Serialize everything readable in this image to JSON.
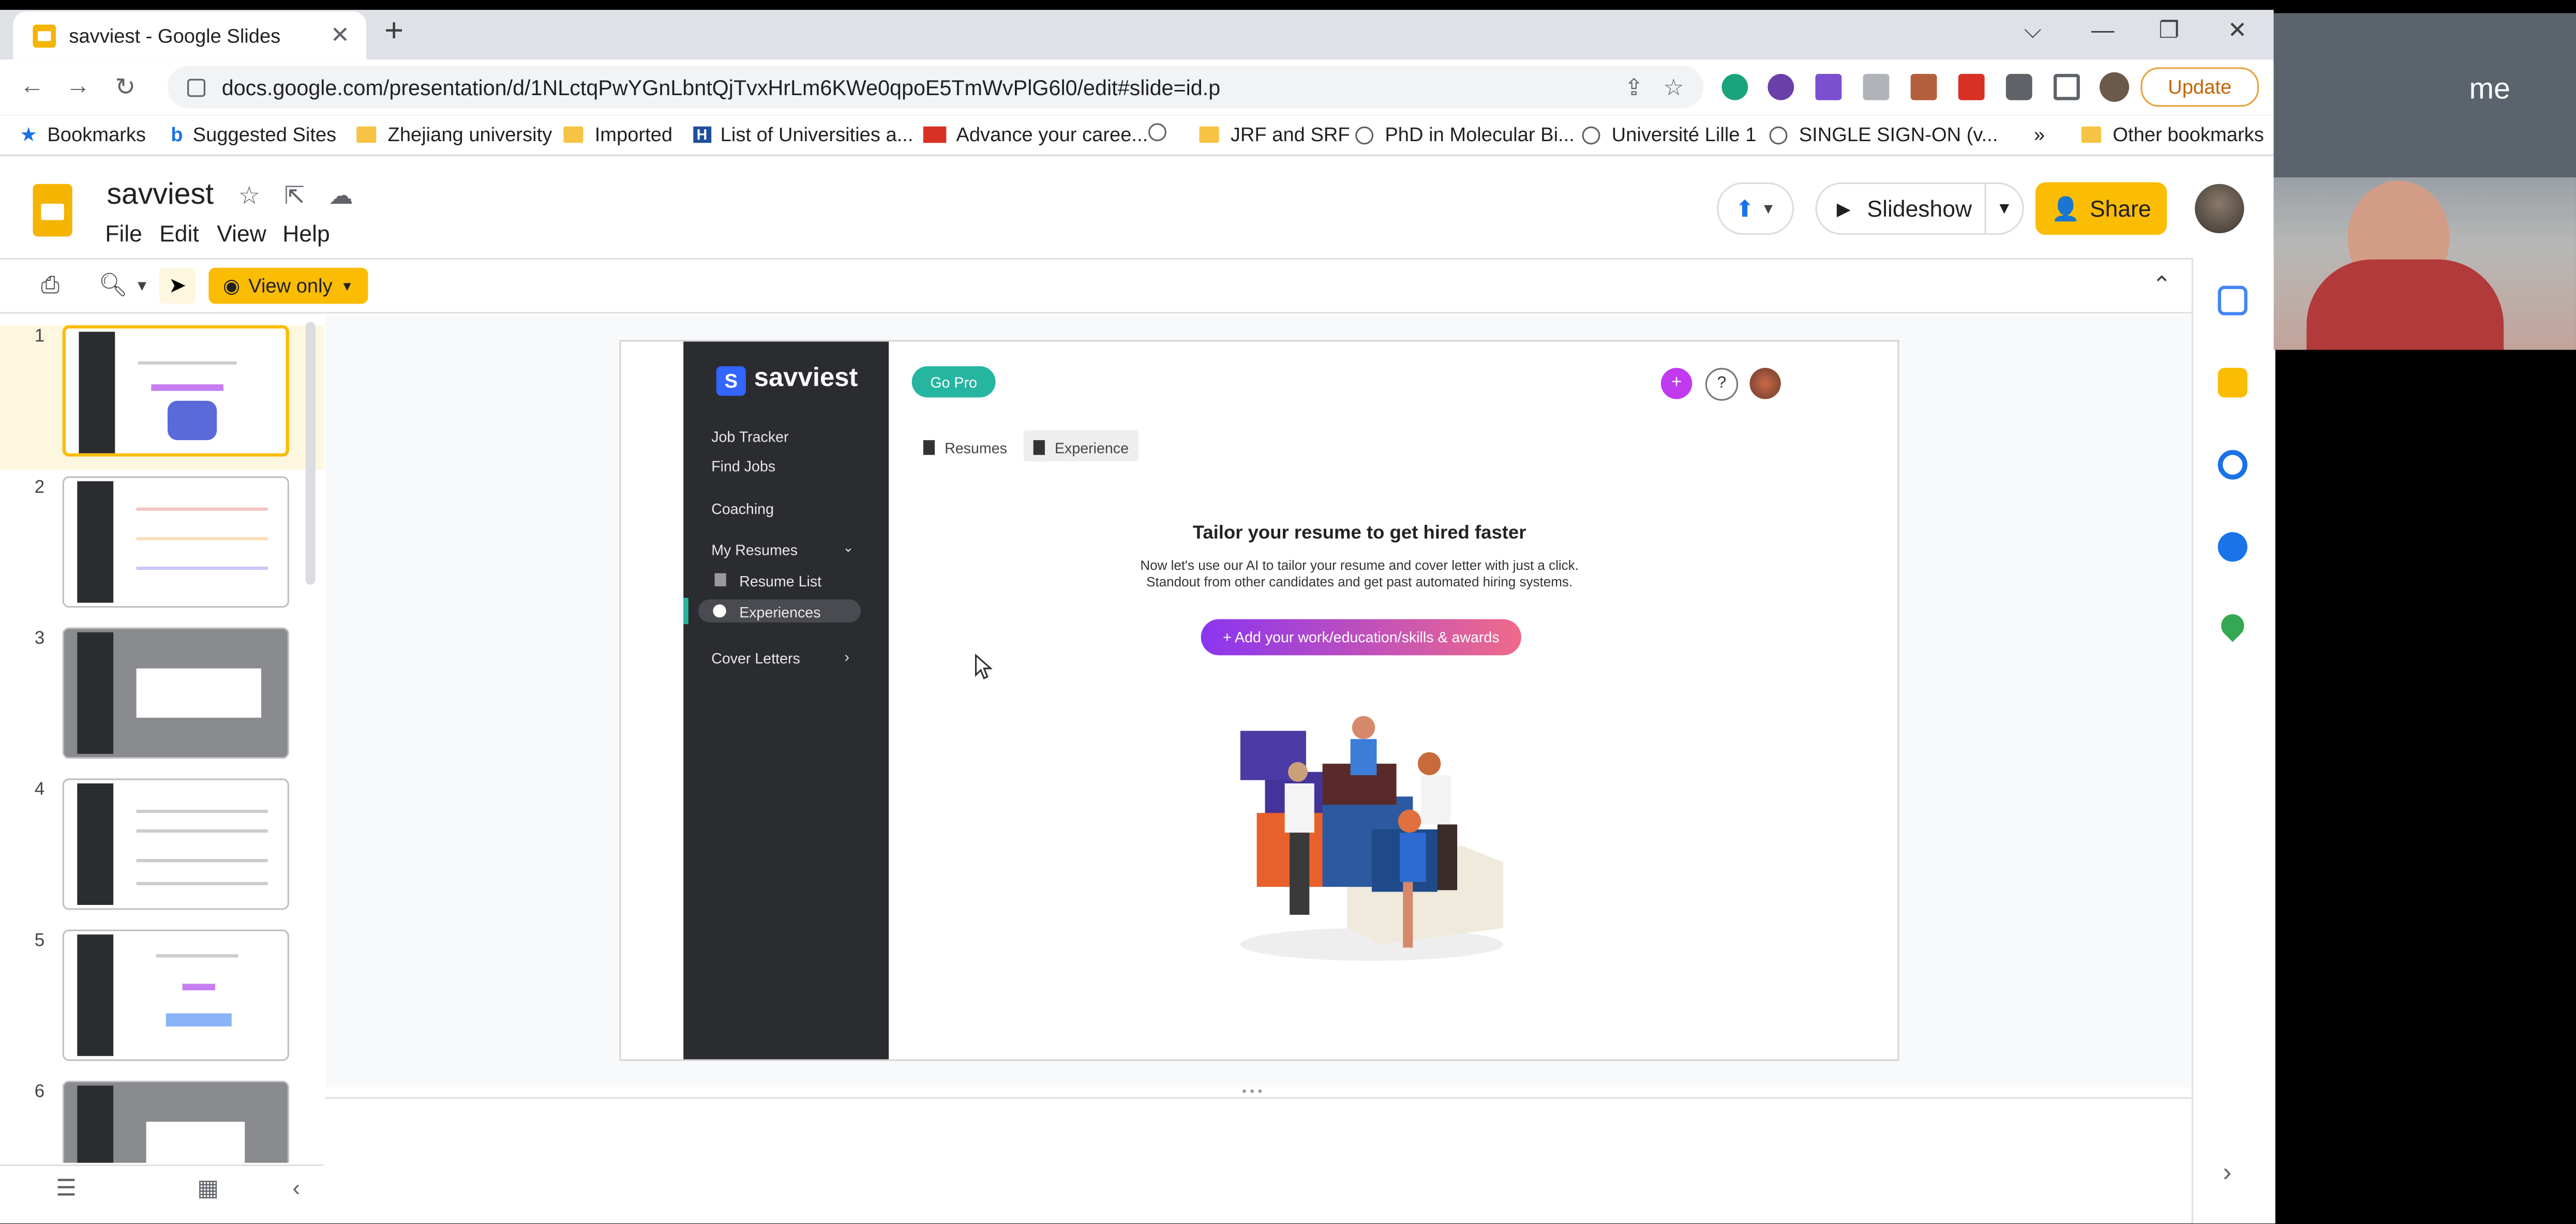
{
  "browser": {
    "tab_title": "savviest - Google Slides",
    "url": "docs.google.com/presentation/d/1NLctqPwYGnLbntQjTvxHrLm6KWe0qpoE5TmWvPlG6l0/edit#slide=id.p",
    "update_label": "Update",
    "bookmarks": [
      "Bookmarks",
      "Suggested Sites",
      "Zhejiang university",
      "Imported",
      "List of Universities a...",
      "Advance your caree...",
      "JRF and SRF",
      "PhD in Molecular Bi...",
      "Université Lille 1",
      "SINGLE SIGN-ON (v...",
      "»",
      "Other bookmarks"
    ]
  },
  "slides": {
    "doc_title": "savviest",
    "menu": [
      "File",
      "Edit",
      "View",
      "Help"
    ],
    "slideshow_label": "Slideshow",
    "share_label": "Share",
    "view_only_label": "View only",
    "slide_numbers": [
      "1",
      "2",
      "3",
      "4",
      "5",
      "6"
    ],
    "selected_slide": 1
  },
  "slide_content": {
    "brand": "savviest",
    "logo_letter": "S",
    "go_pro": "Go Pro",
    "nav": [
      "Job Tracker",
      "Find Jobs",
      "Coaching",
      "My Resumes",
      "Resume List",
      "Experiences",
      "Cover Letters"
    ],
    "tabs": [
      "Resumes",
      "Experience"
    ],
    "help": "?",
    "plus": "+",
    "headline": "Tailor your resume to get hired faster",
    "sub1": "Now let's use our AI to tailor your resume and cover letter with just a click.",
    "sub2": "Standout from other candidates and get past automated hiring systems.",
    "cta": "+ Add your work/education/skills & awards"
  },
  "webcam": {
    "label": "me"
  },
  "colors": {
    "slides_yellow": "#fbbc04",
    "sidebar_dark": "#2b2c30",
    "go_pro_teal": "#26b5a0",
    "cta_gradient_start": "#8a35f0",
    "cta_gradient_end": "#f06a8a"
  }
}
